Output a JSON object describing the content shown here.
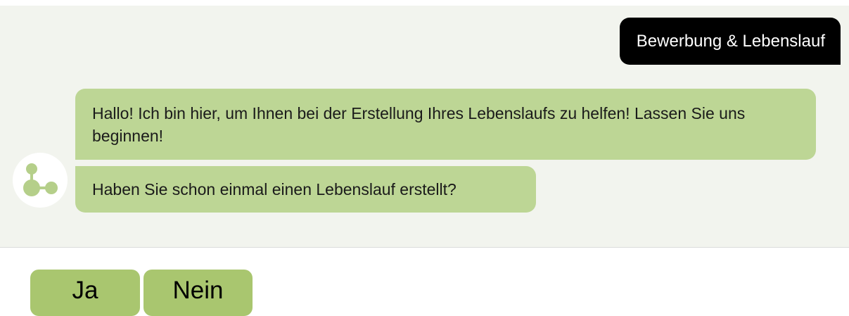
{
  "colors": {
    "chat_background": "#f2f4ee",
    "user_bubble": "#000000",
    "bot_bubble": "#bdd695",
    "reply_button": "#a9c66f",
    "avatar_icon": "#b5cf8a"
  },
  "conversation": {
    "user_message": "Bewerbung & Lebenslauf",
    "bot_avatar_icon": "molecule-icon",
    "bot_messages": [
      "Hallo! Ich bin hier, um Ihnen bei der Erstellung Ihres Lebenslaufs zu helfen! Lassen Sie uns beginnen!",
      "Haben Sie schon einmal einen Lebenslauf erstellt?"
    ]
  },
  "quick_replies": [
    {
      "label": "Ja"
    },
    {
      "label": "Nein"
    }
  ]
}
